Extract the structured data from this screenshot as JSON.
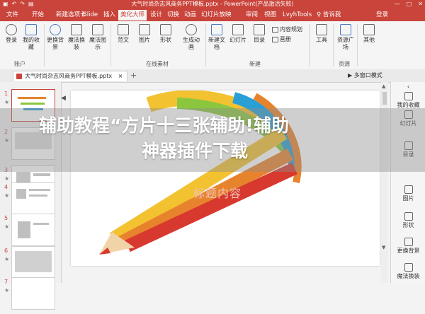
{
  "titlebar": {
    "title": "大气时尚杂志风商务PPT模板.pptx - PowerPoint(产品激活失败)",
    "min": "—",
    "max": "□",
    "close": "✕"
  },
  "tabs": [
    "文件",
    "开始",
    "新建选项卡",
    "iSlide",
    "插入",
    "美化大师",
    "设计",
    "切换",
    "动画",
    "幻灯片放映",
    "审阅",
    "视图",
    "LvyhTools",
    "♀ 告诉我",
    "登录"
  ],
  "active_tab": "美化大师",
  "ribbon": {
    "login": "登录",
    "fav": "我的收藏",
    "bg_change": "更换背景",
    "magic_swap": "魔法换装",
    "magic_diagram": "魔法图示",
    "template": "范文",
    "image": "图片",
    "shape": "形状",
    "anim": "生成动画",
    "new_doc": "新建文档",
    "slides": "幻灯片",
    "toc": "目录",
    "content_plan": "内容规划",
    "canvas": "画册",
    "tools": "工具",
    "resource": "资源广场",
    "other": "其他",
    "groups": {
      "account": "账户",
      "online": "在线素材",
      "new": "新建",
      "resource": "资源"
    }
  },
  "doc_tab": {
    "name": "大气时尚杂志风商务PPT模板.pptx",
    "close": "×",
    "add": "+",
    "mode": "▶ 多窗口模式"
  },
  "thumbnails": [
    {
      "num": "1",
      "star": "★"
    },
    {
      "num": "2",
      "star": "★"
    },
    {
      "num": "3",
      "star": "★"
    },
    {
      "num": "4",
      "star": "★"
    },
    {
      "num": "5",
      "star": "★"
    },
    {
      "num": "6",
      "star": "★"
    },
    {
      "num": "7",
      "star": "★"
    }
  ],
  "slide": {
    "subtitle": "标题内容"
  },
  "right_panel": [
    "我的收藏",
    "幻灯片",
    "目录",
    "图片",
    "形状",
    "更换背景",
    "魔法换装"
  ],
  "watermark": {
    "line1": "辅助教程“方片十三张辅助!辅助",
    "line2": "神器插件下载"
  },
  "colors": {
    "accent": "#c9443b",
    "ribbon_bg": "#f5f5f5",
    "pencil_yellow": "#f2c230",
    "pencil_orange": "#e8832d",
    "pencil_red": "#d8392f",
    "pencil_green": "#8cc63f",
    "pencil_blue": "#2a9fd6"
  }
}
